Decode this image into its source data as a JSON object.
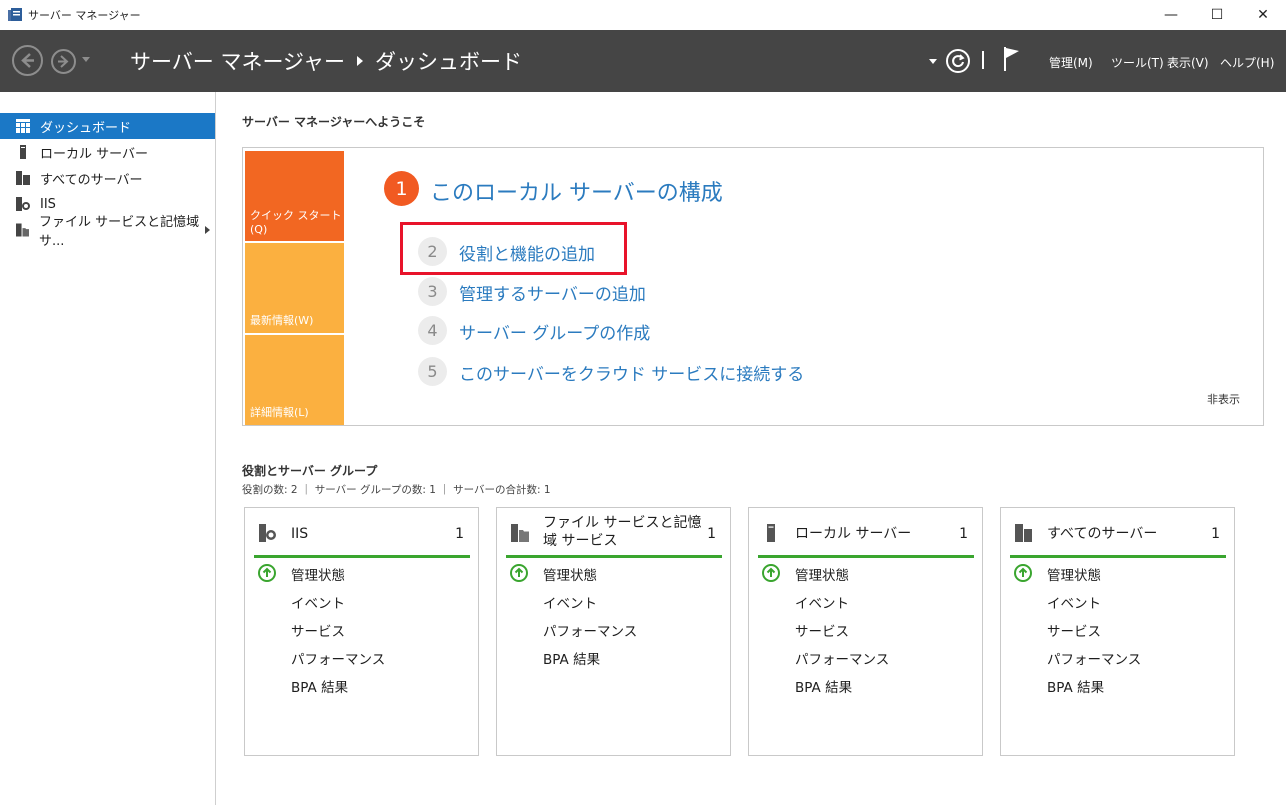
{
  "window": {
    "title": "サーバー マネージャー",
    "minimize_glyph": "—",
    "maximize_glyph": "☐",
    "close_glyph": "✕"
  },
  "header": {
    "breadcrumb_root": "サーバー マネージャー",
    "breadcrumb_current": "ダッシュボード",
    "menus": [
      "管理(M)",
      "ツール(T)",
      "表示(V)",
      "ヘルプ(H)"
    ]
  },
  "sidebar": {
    "items": [
      {
        "label": "ダッシュボード",
        "icon": "dashboard-icon",
        "selected": true
      },
      {
        "label": "ローカル サーバー",
        "icon": "server-icon"
      },
      {
        "label": "すべてのサーバー",
        "icon": "all-servers-icon"
      },
      {
        "label": "IIS",
        "icon": "iis-icon"
      },
      {
        "label": "ファイル サービスと記憶域 サ...",
        "icon": "file-services-icon",
        "has_submenu": true
      }
    ]
  },
  "main": {
    "welcome": "サーバー マネージャーへようこそ",
    "quickstart": {
      "tiles": [
        "クイック スタート(Q)",
        "最新情報(W)",
        "詳細情報(L)"
      ],
      "step1": {
        "num": "1",
        "label": "このローカル サーバーの構成"
      },
      "steps": [
        {
          "num": "2",
          "label": "役割と機能の追加"
        },
        {
          "num": "3",
          "label": "管理するサーバーの追加"
        },
        {
          "num": "4",
          "label": "サーバー グループの作成"
        },
        {
          "num": "5",
          "label": "このサーバーをクラウド サービスに接続する"
        }
      ],
      "hide": "非表示"
    },
    "roles": {
      "title": "役割とサーバー グループ",
      "counts": "役割の数: 2 ｜ サーバー グループの数: 1 ｜ サーバーの合計数: 1",
      "cards": [
        {
          "title": "IIS",
          "count": "1",
          "icon": "iis-icon",
          "rows": [
            "管理状態",
            "イベント",
            "サービス",
            "パフォーマンス",
            "BPA 結果"
          ]
        },
        {
          "title": "ファイル サービスと記憶域 サービス",
          "count": "1",
          "icon": "file-services-icon",
          "rows": [
            "管理状態",
            "イベント",
            "パフォーマンス",
            "BPA 結果"
          ]
        },
        {
          "title": "ローカル サーバー",
          "count": "1",
          "icon": "server-icon",
          "rows": [
            "管理状態",
            "イベント",
            "サービス",
            "パフォーマンス",
            "BPA 結果"
          ]
        },
        {
          "title": "すべてのサーバー",
          "count": "1",
          "icon": "all-servers-icon",
          "rows": [
            "管理状態",
            "イベント",
            "サービス",
            "パフォーマンス",
            "BPA 結果"
          ]
        }
      ]
    }
  },
  "colors": {
    "header_bg": "#454545",
    "selection": "#1b78c6",
    "link": "#2b7bbf",
    "tile_orange_dark": "#f26722",
    "tile_orange_light": "#fbb040",
    "status_green": "#3aa52f",
    "highlight_red": "#e8132a"
  }
}
